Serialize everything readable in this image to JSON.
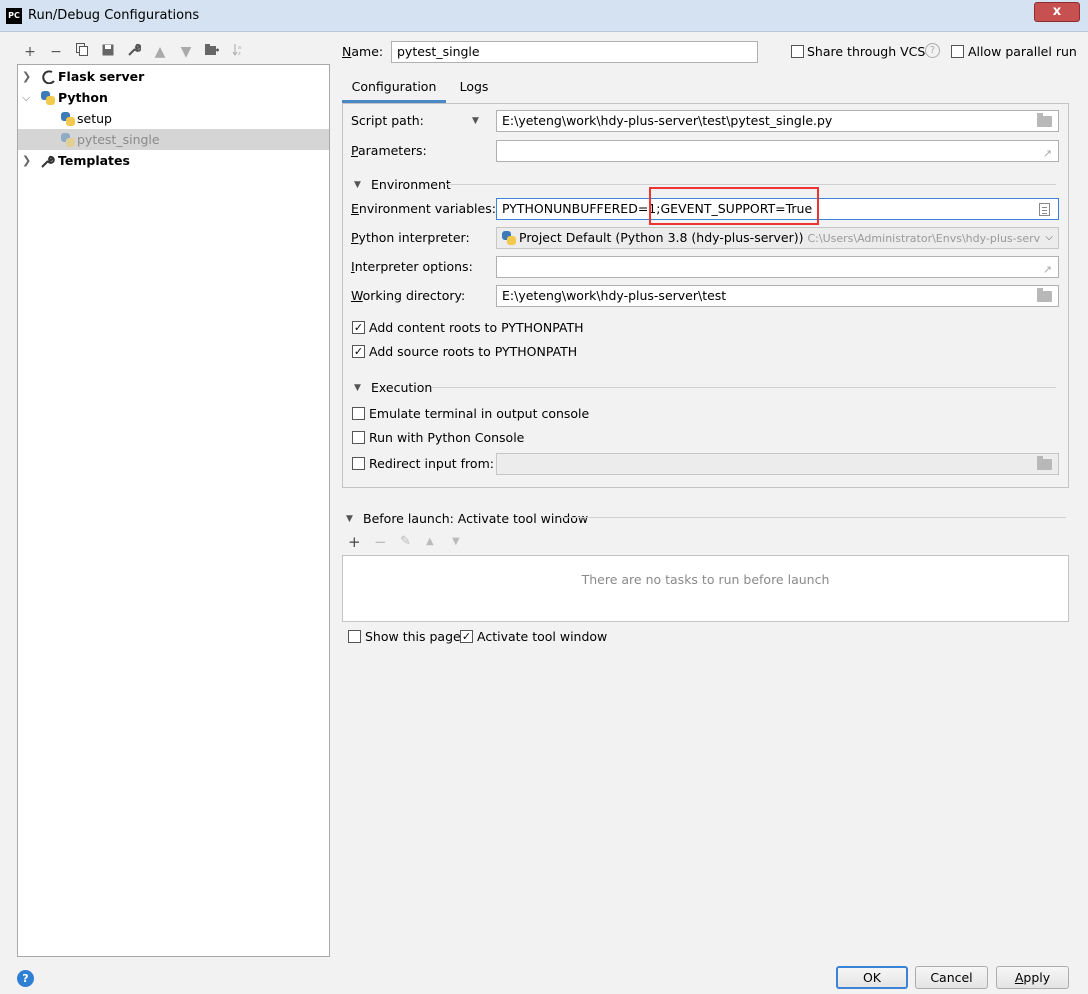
{
  "window": {
    "title": "Run/Debug Configurations",
    "app_icon_text": "PC",
    "close_label": "x"
  },
  "toolbar": {
    "icons": [
      "plus-icon",
      "minus-icon",
      "copy-icon",
      "save-icon",
      "wrench-icon",
      "arrow-up-icon",
      "arrow-down-icon",
      "new-folder-icon",
      "sort-icon"
    ]
  },
  "tree": {
    "items": [
      {
        "label": "Flask server",
        "level": 0,
        "expanded": false,
        "icon": "flask-icon",
        "bold": true
      },
      {
        "label": "Python",
        "level": 0,
        "expanded": true,
        "icon": "python-icon",
        "bold": true
      },
      {
        "label": "setup",
        "level": 1,
        "icon": "python-icon",
        "bold": false
      },
      {
        "label": "pytest_single",
        "level": 1,
        "icon": "python-icon",
        "bold": false,
        "selected": true
      },
      {
        "label": "Templates",
        "level": 0,
        "expanded": false,
        "icon": "wrench-icon",
        "bold": true
      }
    ]
  },
  "header": {
    "name_label_prefix": "N",
    "name_label_rest": "ame:",
    "name_value": "pytest_single",
    "share_vcs_label": "Share through VCS",
    "share_vcs_checked": false,
    "allow_parallel_label": "Allow parallel run",
    "allow_parallel_checked": false,
    "help_glyph": "?"
  },
  "tabs": [
    {
      "label": "Configuration",
      "active": true
    },
    {
      "label": "Logs",
      "active": false
    }
  ],
  "config": {
    "script_path_label": "Script path:",
    "script_path_value": "E:\\yeteng\\work\\hdy-plus-server\\test\\pytest_single.py",
    "parameters_label": "Parameters:",
    "parameters_value": "",
    "environment_section": "Environment",
    "env_vars_label": "Environment variables:",
    "env_vars_value": "PYTHONUNBUFFERED=1;GEVENT_SUPPORT=True",
    "interpreter_label": "Python interpreter:",
    "interpreter_value": "Project Default (Python 3.8 (hdy-plus-server))",
    "interpreter_path": "C:\\Users\\Administrator\\Envs\\hdy-plus-server\\Scr",
    "interp_options_label": "Interpreter options:",
    "interp_options_value": "",
    "working_dir_label": "Working directory:",
    "working_dir_value": "E:\\yeteng\\work\\hdy-plus-server\\test",
    "add_content_roots_label": "Add content roots to PYTHONPATH",
    "add_content_roots_checked": true,
    "add_source_roots_label": "Add source roots to PYTHONPATH",
    "add_source_roots_checked": true,
    "execution_section": "Execution",
    "emulate_terminal_label": "Emulate terminal in output console",
    "emulate_terminal_checked": false,
    "run_with_console_label": "Run with Python Console",
    "run_with_console_checked": false,
    "redirect_input_label": "Redirect input from:",
    "redirect_input_checked": false,
    "redirect_input_value": ""
  },
  "before_launch": {
    "title": "Before launch: Activate tool window",
    "empty_text": "There are no tasks to run before launch",
    "show_page_label": "Show this page",
    "show_page_checked": false,
    "activate_tool_label": "Activate tool window",
    "activate_tool_checked": true
  },
  "buttons": {
    "ok": "OK",
    "cancel": "Cancel",
    "apply": "Apply"
  },
  "colors": {
    "accent": "#3b83d6",
    "highlight_box": "#e33333",
    "selected_row": "#d5d5d5"
  }
}
